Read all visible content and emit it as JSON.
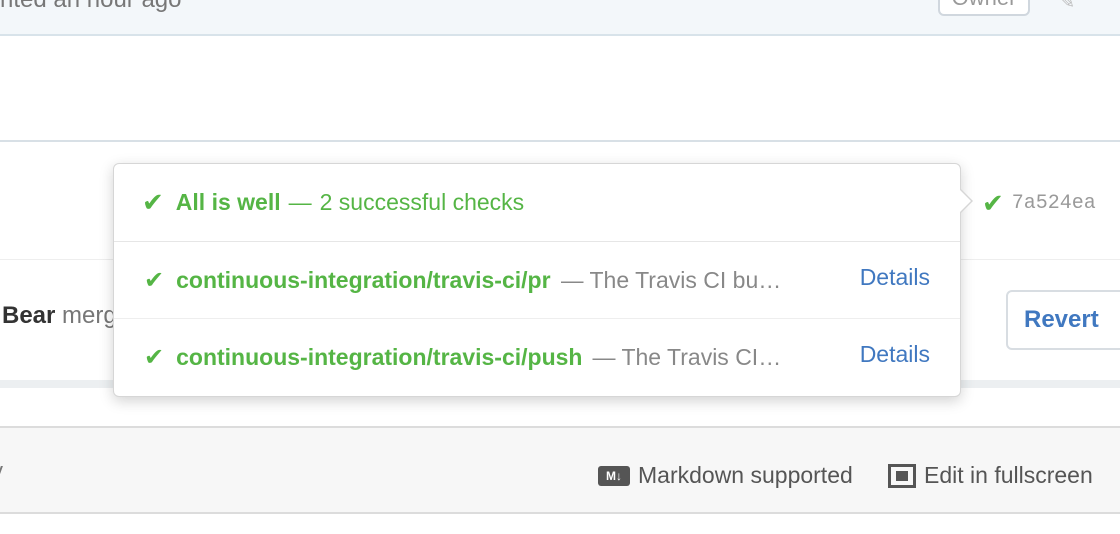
{
  "comment": {
    "time_text": "nted an hour ago",
    "owner_badge": "Owner"
  },
  "commit": {
    "sha": "7a524ea"
  },
  "popover": {
    "header_title": "All is well",
    "header_separator": "—",
    "header_summary": "2 successful checks",
    "checks": [
      {
        "context": "continuous-integration/travis-ci/pr",
        "description": "— The Travis CI bu…",
        "link_label": "Details"
      },
      {
        "context": "continuous-integration/travis-ci/push",
        "description": "— The Travis CI…",
        "link_label": "Details"
      }
    ]
  },
  "merge": {
    "user": "Bear",
    "text": "merg",
    "revert_label": "Revert"
  },
  "toolbar": {
    "edge_text": "v",
    "markdown_icon_text": "M↓",
    "markdown_label": "Markdown supported",
    "fullscreen_label": "Edit in fullscreen"
  },
  "colors": {
    "success": "#55b545",
    "link": "#4078c0",
    "muted": "#888888"
  }
}
